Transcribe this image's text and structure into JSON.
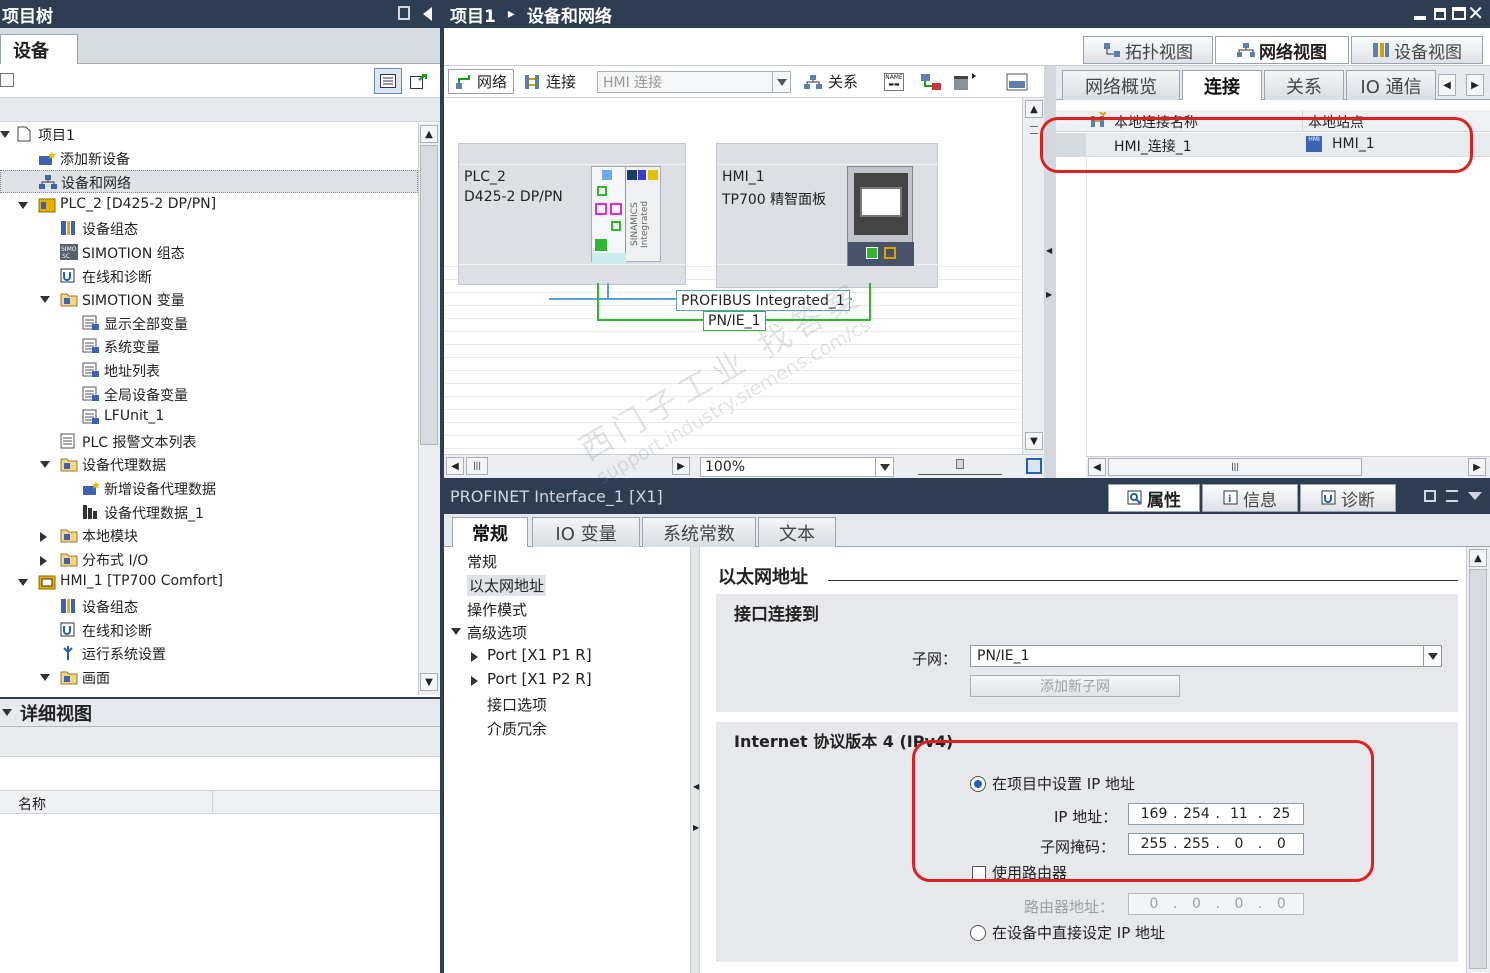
{
  "left_panel": {
    "title": "项目树",
    "tab_devices": "设备",
    "tree": [
      {
        "label": "项目1",
        "indent": 0,
        "exp": "down",
        "icon": "project-icon"
      },
      {
        "label": "添加新设备",
        "indent": 1,
        "exp": "",
        "icon": "add-device-icon"
      },
      {
        "label": "设备和网络",
        "indent": 1,
        "exp": "",
        "icon": "network-icon"
      },
      {
        "label": "PLC_2 [D425-2 DP/PN]",
        "indent": 1,
        "exp": "down",
        "icon": "plc-icon"
      },
      {
        "label": "设备组态",
        "indent": 2,
        "exp": "",
        "icon": "device-config-icon"
      },
      {
        "label": "SIMOTION 组态",
        "indent": 2,
        "exp": "",
        "icon": "simotion-icon"
      },
      {
        "label": "在线和诊断",
        "indent": 2,
        "exp": "",
        "icon": "diagnostics-icon"
      },
      {
        "label": "SIMOTION 变量",
        "indent": 2,
        "exp": "down",
        "icon": "folder-icon"
      },
      {
        "label": "显示全部变量",
        "indent": 3,
        "exp": "",
        "icon": "tag-table-icon"
      },
      {
        "label": "系统变量",
        "indent": 3,
        "exp": "",
        "icon": "tag-table-icon"
      },
      {
        "label": "地址列表",
        "indent": 3,
        "exp": "",
        "icon": "tag-table-icon"
      },
      {
        "label": "全局设备变量",
        "indent": 3,
        "exp": "",
        "icon": "tag-table-icon"
      },
      {
        "label": "LFUnit_1",
        "indent": 3,
        "exp": "",
        "icon": "tag-table-icon"
      },
      {
        "label": "PLC 报警文本列表",
        "indent": 2,
        "exp": "",
        "icon": "text-list-icon"
      },
      {
        "label": "设备代理数据",
        "indent": 2,
        "exp": "down",
        "icon": "folder-icon"
      },
      {
        "label": "新增设备代理数据",
        "indent": 3,
        "exp": "",
        "icon": "add-device-icon"
      },
      {
        "label": "设备代理数据_1",
        "indent": 3,
        "exp": "",
        "icon": "proxy-data-icon"
      },
      {
        "label": "本地模块",
        "indent": 2,
        "exp": "right",
        "icon": "folder-icon"
      },
      {
        "label": "分布式 I/O",
        "indent": 2,
        "exp": "right",
        "icon": "folder-icon"
      },
      {
        "label": "HMI_1 [TP700 Comfort]",
        "indent": 1,
        "exp": "down",
        "icon": "hmi-icon"
      },
      {
        "label": "设备组态",
        "indent": 2,
        "exp": "",
        "icon": "device-config-icon"
      },
      {
        "label": "在线和诊断",
        "indent": 2,
        "exp": "",
        "icon": "diagnostics-icon"
      },
      {
        "label": "运行系统设置",
        "indent": 2,
        "exp": "",
        "icon": "runtime-settings-icon"
      },
      {
        "label": "画面",
        "indent": 2,
        "exp": "down",
        "icon": "folder-icon"
      }
    ],
    "detail_view_title": "详细视图",
    "detail_col_name": "名称"
  },
  "main": {
    "breadcrumb_project": "项目1",
    "breadcrumb_sep": "▸",
    "breadcrumb_page": "设备和网络",
    "view_tabs": {
      "topology": "拓扑视图",
      "network": "网络视图",
      "device": "设备视图"
    },
    "toolbar": {
      "network": "网络",
      "connections": "连接",
      "connection_select": "HMI 连接",
      "relations": "关系",
      "zoom": "100%"
    },
    "plc": {
      "name": "PLC_2",
      "model": "D425-2 DP/PN",
      "side_label": "SINAMICS Integrated"
    },
    "hmi": {
      "name": "HMI_1",
      "model": "TP700 精智面板"
    },
    "profibus_label": "PROFIBUS Integrated_1",
    "pnie_label": "PN/IE_1",
    "overview_tabs": {
      "overview": "网络概览",
      "connections": "连接",
      "relations": "关系",
      "io": "IO 通信"
    },
    "conn_table": {
      "col1": "本地连接名称",
      "col2": "本地站点",
      "rows": [
        {
          "name": "HMI_连接_1",
          "station": "HMI_1"
        }
      ]
    }
  },
  "properties": {
    "title": "PROFINET Interface_1 [X1]",
    "side_tabs": {
      "properties": "属性",
      "info": "信息",
      "diagnostics": "诊断"
    },
    "tabs": {
      "general": "常规",
      "io_tags": "IO 变量",
      "system_constants": "系统常数",
      "texts": "文本"
    },
    "nav": [
      {
        "label": "常规",
        "indent": 0,
        "exp": "",
        "selected": false
      },
      {
        "label": "以太网地址",
        "indent": 0,
        "exp": "",
        "selected": true
      },
      {
        "label": "操作模式",
        "indent": 0,
        "exp": "",
        "selected": false
      },
      {
        "label": "高级选项",
        "indent": 0,
        "exp": "down",
        "selected": false
      },
      {
        "label": "Port [X1 P1 R]",
        "indent": 1,
        "exp": "right",
        "selected": false
      },
      {
        "label": "Port [X1 P2 R]",
        "indent": 1,
        "exp": "right",
        "selected": false
      },
      {
        "label": "接口选项",
        "indent": 1,
        "exp": "",
        "selected": false
      },
      {
        "label": "介质冗余",
        "indent": 1,
        "exp": "",
        "selected": false
      }
    ],
    "section_title": "以太网地址",
    "interface_connected": "接口连接到",
    "subnet_label": "子网：",
    "subnet_value": "PN/IE_1",
    "add_subnet": "添加新子网",
    "ipv4_title": "Internet 协议版本 4 (IPv4)",
    "set_in_project": "在项目中设置 IP 地址",
    "ip_label": "IP 地址：",
    "ip": [
      "169",
      "254",
      "11",
      "25"
    ],
    "mask_label": "子网掩码：",
    "mask": [
      "255",
      "255",
      "0",
      "0"
    ],
    "use_router": "使用路由器",
    "router_label": "路由器地址：",
    "router": [
      "0",
      "0",
      "0",
      "0"
    ],
    "set_on_device": "在设备中直接设定 IP 地址"
  },
  "watermark": {
    "line1": "西门子工业 找答案",
    "line2": "support.industry.siemens.com/cs"
  },
  "colors": {
    "titlebar": "#2d3d52",
    "highlight_red": "#e02020",
    "profinet_green": "#2eb82e",
    "profibus_blue": "#5aa0d8"
  }
}
